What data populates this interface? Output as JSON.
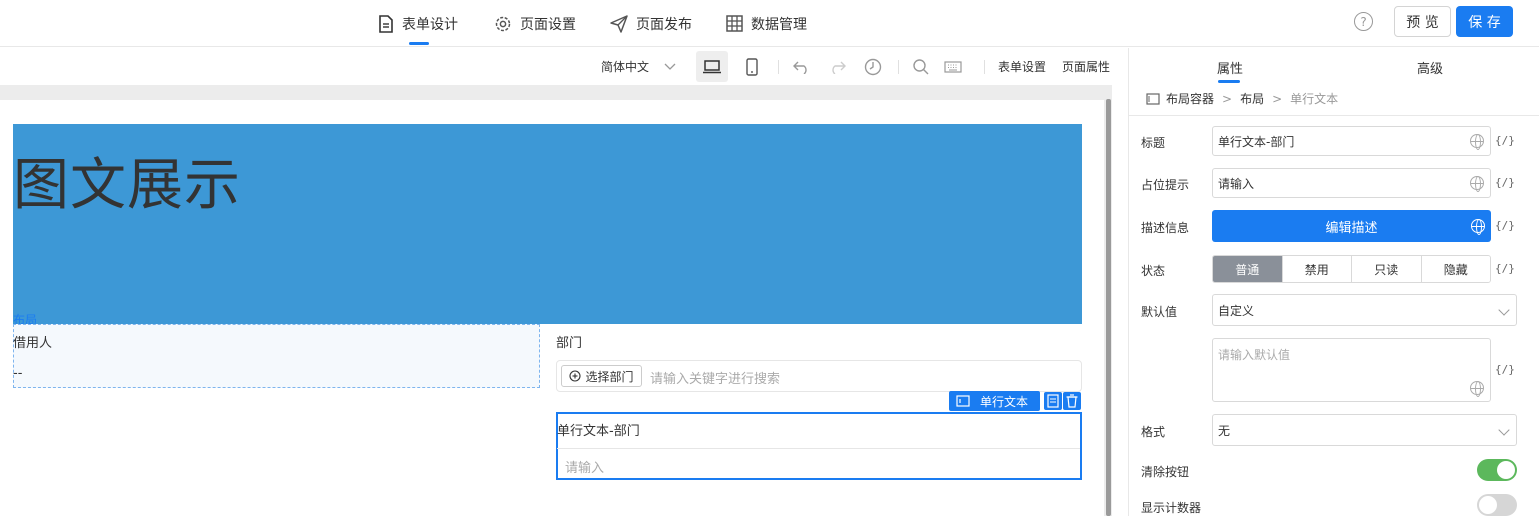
{
  "topnav": {
    "tabs": [
      {
        "label": "表单设计",
        "icon": "document-icon",
        "active": true
      },
      {
        "label": "页面设置",
        "icon": "gear-icon"
      },
      {
        "label": "页面发布",
        "icon": "send-icon"
      },
      {
        "label": "数据管理",
        "icon": "grid-icon"
      }
    ],
    "help": "?",
    "preview_label": "预 览",
    "save_label": "保 存",
    "accent_color": "#1a7cf1"
  },
  "toolbar": {
    "language": "简体中文",
    "form_settings": "表单设置",
    "page_properties": "页面属性"
  },
  "canvas": {
    "banner_title": "图文展示",
    "banner_color": "#3d98d6",
    "layout_tag": "布局",
    "borrower_label": "借用人",
    "borrower_value": "--",
    "dept_label": "部门",
    "dept_select_button": "选择部门",
    "dept_search_placeholder": "请输入关键字进行搜索",
    "selected_tag": "单行文本",
    "selected_label": "单行文本-部门",
    "selected_placeholder": "请输入"
  },
  "panel": {
    "tabs": [
      "属性",
      "高级"
    ],
    "breadcrumb": [
      "布局容器",
      "布局",
      "单行文本"
    ],
    "title_label": "标题",
    "title_value": "单行文本-部门",
    "placeholder_label": "占位提示",
    "placeholder_value": "请输入",
    "desc_label": "描述信息",
    "desc_button": "编辑描述",
    "status_label": "状态",
    "status_options": [
      "普通",
      "禁用",
      "只读",
      "隐藏"
    ],
    "status_selected": "普通",
    "default_label": "默认值",
    "default_value": "自定义",
    "default_placeholder": "请输入默认值",
    "format_label": "格式",
    "format_value": "无",
    "clear_label": "清除按钮",
    "clear_on": true,
    "counter_label": "显示计数器",
    "counter_on": false,
    "expr_symbol": "{/}"
  }
}
